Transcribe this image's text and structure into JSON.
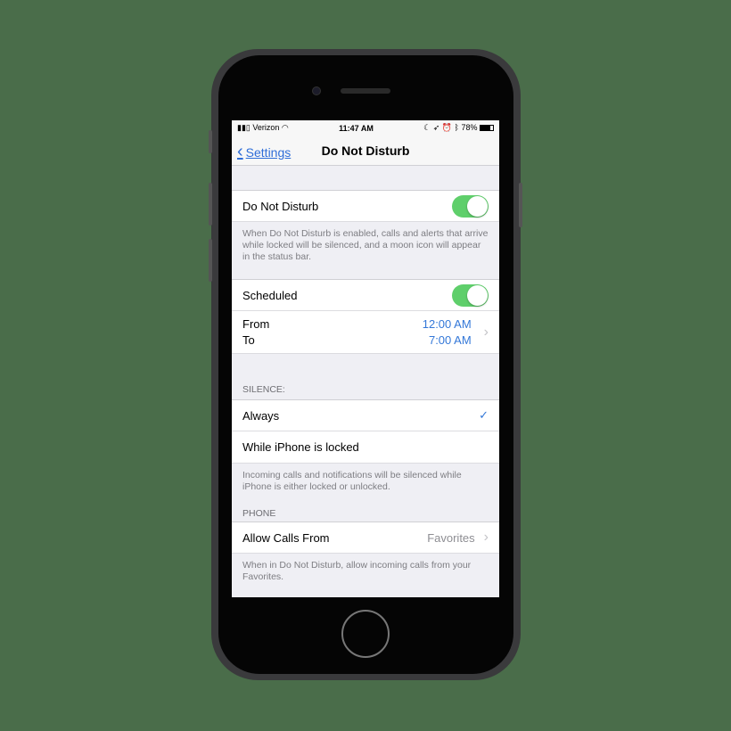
{
  "status_bar": {
    "carrier": "Verizon",
    "time": "11:47 AM",
    "battery": "78%"
  },
  "nav": {
    "back_label": "Settings",
    "title": "Do Not Disturb"
  },
  "dnd": {
    "label": "Do Not Disturb",
    "enabled": true,
    "footer": "When Do Not Disturb is enabled, calls and alerts that arrive while locked will be silenced, and a moon icon will appear in the status bar."
  },
  "scheduled": {
    "label": "Scheduled",
    "enabled": true,
    "from_label": "From",
    "to_label": "To",
    "from_value": "12:00 AM",
    "to_value": "7:00 AM"
  },
  "silence": {
    "header": "SILENCE:",
    "options": [
      {
        "label": "Always",
        "selected": true
      },
      {
        "label": "While iPhone is locked",
        "selected": false
      }
    ],
    "footer": "Incoming calls and notifications will be silenced while iPhone is either locked or unlocked."
  },
  "phone": {
    "header": "PHONE",
    "allow_label": "Allow Calls From",
    "allow_value": "Favorites",
    "footer": "When in Do Not Disturb, allow incoming calls from your Favorites."
  },
  "colors": {
    "accent": "#3478d8",
    "toggle_on": "#5fcf6b"
  }
}
